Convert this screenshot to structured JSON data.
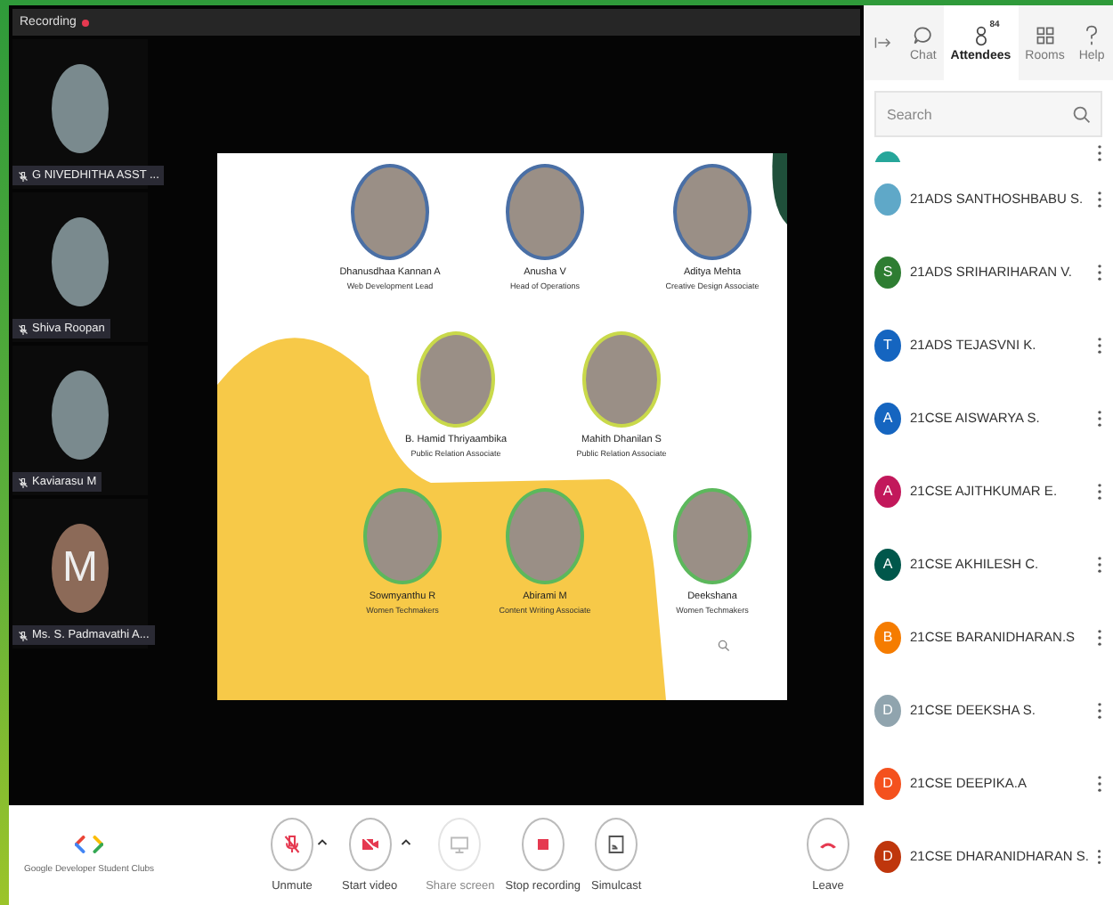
{
  "recording": {
    "label": "Recording"
  },
  "participants": [
    {
      "name": "G NIVEDHITHA ASST ...",
      "kind": "photo"
    },
    {
      "name": "Shiva Roopan",
      "kind": "photo"
    },
    {
      "name": "Kaviarasu M",
      "kind": "photo"
    },
    {
      "name": "Ms. S. Padmavathi A...",
      "kind": "letter",
      "initial": "M"
    }
  ],
  "slide": {
    "people": [
      {
        "name": "Dhanusdhaa Kannan A",
        "role": "Web Development Lead",
        "color": "#4a6fa5"
      },
      {
        "name": "Anusha V",
        "role": "Head of Operations",
        "color": "#4a6fa5"
      },
      {
        "name": "Aditya Mehta",
        "role": "Creative Design Associate",
        "color": "#4a6fa5"
      },
      {
        "name": "B. Hamid Thriyaambika",
        "role": "Public Relation Associate",
        "color": "#c9d94a"
      },
      {
        "name": "Mahith Dhanilan S",
        "role": "Public Relation Associate",
        "color": "#c9d94a"
      },
      {
        "name": "Sowmyanthu R",
        "role": "Women Techmakers",
        "color": "#5cb85c"
      },
      {
        "name": "Abirami M",
        "role": "Content Writing Associate",
        "color": "#5cb85c"
      },
      {
        "name": "Deekshana",
        "role": "Women Techmakers",
        "color": "#5cb85c"
      }
    ]
  },
  "toolbar": {
    "brand": "Google Developer Student Clubs",
    "buttons": [
      {
        "kind": "mic",
        "label": "Unmute",
        "disabled": false,
        "caret": true
      },
      {
        "kind": "video",
        "label": "Start video",
        "disabled": false,
        "caret": true
      },
      {
        "kind": "share",
        "label": "Share screen",
        "disabled": true,
        "caret": false
      },
      {
        "kind": "stop",
        "label": "Stop recording",
        "disabled": false,
        "caret": false
      },
      {
        "kind": "cast",
        "label": "Simulcast",
        "disabled": false,
        "caret": false
      },
      {
        "kind": "leave",
        "label": "Leave",
        "disabled": false,
        "caret": false
      }
    ]
  },
  "panel": {
    "tabs": [
      {
        "kind": "chat",
        "label": "Chat",
        "selected": false
      },
      {
        "kind": "people",
        "label": "Attendees",
        "selected": true,
        "badge": "84"
      },
      {
        "kind": "rooms",
        "label": "Rooms",
        "selected": false
      },
      {
        "kind": "help",
        "label": "Help",
        "selected": false
      }
    ],
    "search": {
      "placeholder": "Search"
    },
    "attendees": [
      {
        "kind": "letter",
        "color": "#26a69a"
      },
      {
        "name": "21ADS SANTHOSHBABU S.",
        "kind": "photo",
        "color": "#5fa8c8"
      },
      {
        "name": "21ADS SRIHARIHARAN V.",
        "kind": "letter",
        "initial": "S",
        "color": "#2e7d32"
      },
      {
        "name": "21ADS TEJASVNI K.",
        "kind": "letter",
        "initial": "T",
        "color": "#1565c0"
      },
      {
        "name": "21CSE AISWARYA S.",
        "kind": "letter",
        "initial": "A",
        "color": "#1565c0"
      },
      {
        "name": "21CSE AJITHKUMAR E.",
        "kind": "letter",
        "initial": "A",
        "color": "#c2185b"
      },
      {
        "name": "21CSE AKHILESH C.",
        "kind": "letter",
        "initial": "A",
        "color": "#00574b"
      },
      {
        "name": "21CSE BARANIDHARAN.S",
        "kind": "letter",
        "initial": "B",
        "color": "#f57c00"
      },
      {
        "name": "21CSE DEEKSHA S.",
        "kind": "letter",
        "initial": "D",
        "color": "#90a4ae"
      },
      {
        "name": "21CSE DEEPIKA.A",
        "kind": "letter",
        "initial": "D",
        "color": "#f4511e"
      },
      {
        "name": "21CSE DHARANIDHARAN S.",
        "kind": "letter",
        "initial": "D",
        "color": "#bf360c"
      }
    ]
  }
}
